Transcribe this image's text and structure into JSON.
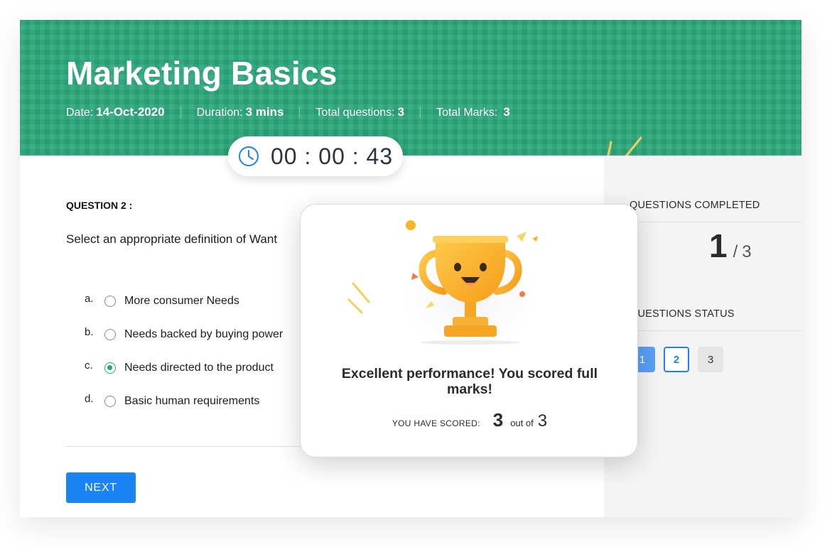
{
  "header": {
    "title": "Marketing Basics",
    "date_label": "Date:",
    "date_value": "14-Oct-2020",
    "duration_label": "Duration:",
    "duration_value": "3 mins",
    "questions_label": "Total questions:",
    "questions_value": "3",
    "marks_label": "Total Marks:",
    "marks_value": "3"
  },
  "timer": {
    "icon": "clock-icon",
    "value": "00 : 00 : 43"
  },
  "question": {
    "label": "QUESTION 2 :",
    "text": "Select an appropriate definition of Want",
    "options": [
      {
        "letter": "a.",
        "text": "More consumer Needs",
        "selected": false
      },
      {
        "letter": "b.",
        "text": "Needs backed by buying power",
        "selected": false
      },
      {
        "letter": "c.",
        "text": "Needs directed to the product",
        "selected": true
      },
      {
        "letter": "d.",
        "text": "Basic human requirements",
        "selected": false
      }
    ]
  },
  "next_button": {
    "label": "NEXT"
  },
  "sidebar": {
    "completed_heading": "QUESTIONS COMPLETED",
    "completed": "1",
    "slash": "/",
    "total": "3",
    "status_heading": "QUESTIONS STATUS",
    "status": [
      {
        "label": "1",
        "state": "answered"
      },
      {
        "label": "2",
        "state": "current"
      },
      {
        "label": "3",
        "state": "pending"
      }
    ]
  },
  "modal": {
    "icon": "trophy-icon",
    "message": "Excellent performance! You scored full marks!",
    "score_label": "YOU HAVE SCORED:",
    "score": "3",
    "out_of": "out of",
    "total": "3"
  },
  "colors": {
    "header_green": "#2aa67a",
    "primary_blue": "#1a84f5",
    "trophy_gold": "#f7a928"
  }
}
